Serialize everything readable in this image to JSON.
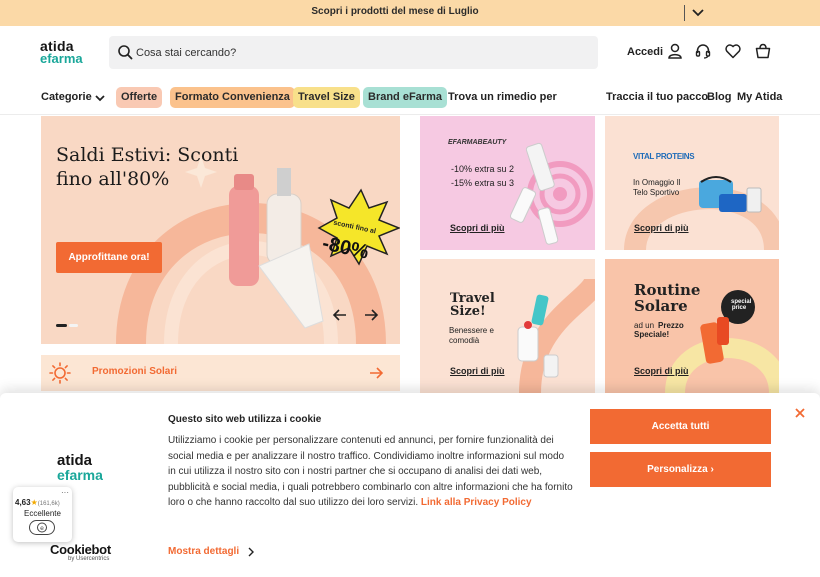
{
  "announcement": {
    "text": "Scopri i prodotti del mese di Luglio"
  },
  "header": {
    "logo_top": "atida",
    "logo_bottom": "efarma",
    "search_placeholder": "Cosa stai cercando?",
    "login_label": "Accedi"
  },
  "nav": {
    "categories_label": "Categorie",
    "pills": [
      {
        "label": "Offerte",
        "color": "#f9c9b3"
      },
      {
        "label": "Formato Convenienza",
        "color": "#fbc28c"
      },
      {
        "label": "Travel Size",
        "color": "#f8e08a"
      },
      {
        "label": "Brand eFarma",
        "color": "#a8e0d4"
      }
    ],
    "remedy_label": "Trova un rimedio per",
    "track_label": "Traccia il tuo pacco",
    "blog_label": "Blog",
    "account_label": "My Atida"
  },
  "hero": {
    "title": "Saldi Estivi: Sconti fino all'80%",
    "cta_label": "Approfittane ora!",
    "badge_small": "sconti fino al",
    "badge_big": "-80%",
    "accent": "#f26a33"
  },
  "cards": [
    {
      "brand": "EFARMABEAUTY",
      "lines": [
        "-10% extra su 2",
        "-15% extra su 3"
      ],
      "link": "Scopri di più"
    },
    {
      "brand": "VITAL PROTEINS",
      "lines": [
        "In Omaggio Il",
        "Telo Sportivo"
      ],
      "link": "Scopri di più"
    },
    {
      "title": "Travel Size!",
      "lines": [
        "Benessere e",
        "comodià"
      ],
      "link": "Scopri di più"
    },
    {
      "title": "Routine Solare",
      "lines": [
        "ad un",
        "Prezzo",
        "Speciale!"
      ],
      "badge": "special price",
      "link": "Scopri di più"
    }
  ],
  "promo": {
    "label": "Promozioni Solari"
  },
  "cookie": {
    "title": "Questo sito web utilizza i cookie",
    "body": "Utilizziamo i cookie per personalizzare contenuti ed annunci, per fornire funzionalità dei social media e per analizzare il nostro traffico. Condividiamo inoltre informazioni sul modo in cui utilizza il nostro sito con i nostri partner che si occupano di analisi dei dati web, pubblicità e social media, i quali potrebbero combinarlo con altre informazioni che ha fornito loro o che hanno raccolto dal suo utilizzo dei loro servizi.",
    "privacy_link": "Link alla Privacy Policy",
    "more_label": "Mostra dettagli",
    "accept_label": "Accetta tutti",
    "customize_label": "Personalizza",
    "cookiebot": "Cookiebot",
    "cookiebot_sub": "by Usercentrics"
  },
  "rating": {
    "score": "4,63",
    "count": "(161,6k)",
    "label": "Eccellente"
  }
}
